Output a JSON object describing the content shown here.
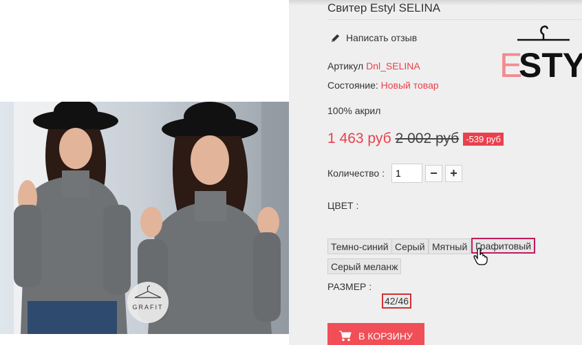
{
  "product": {
    "title": "Свитер Estyl SELINA",
    "review_link": "Написать отзыв",
    "sku_label": "Артикул",
    "sku_value": "Dnl_SELINA",
    "condition_label": "Состояние:",
    "condition_value": "Новый товар",
    "material": "100% акрил"
  },
  "brand_logo": {
    "text": "ESTYL",
    "letter_accent": "E"
  },
  "price": {
    "current": "1 463 руб",
    "old": "2 002 руб",
    "discount": "-539 руб"
  },
  "quantity": {
    "label": "Количество :",
    "value": "1",
    "minus": "−",
    "plus": "+"
  },
  "color": {
    "label": "ЦВЕТ :",
    "options": [
      "Темно-синий",
      "Серый",
      "Мятный",
      "Графитовый",
      "Серый меланж"
    ],
    "selected": "Графитовый"
  },
  "size": {
    "label": "РАЗМЕР :",
    "options": [
      "42/46"
    ],
    "selected": "42/46"
  },
  "cart": {
    "label": "В КОРЗИНУ"
  },
  "photo_badge": {
    "text": "GRAFIT"
  },
  "colors": {
    "accent": "#e8414d",
    "button": "#f04f58",
    "selected_border": "#c2185b",
    "size_border": "#d32f2f"
  }
}
